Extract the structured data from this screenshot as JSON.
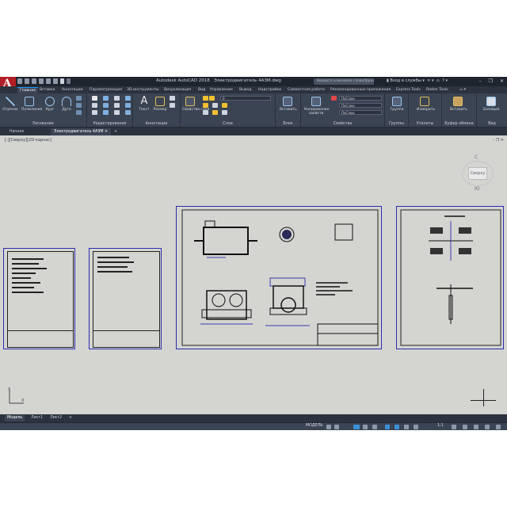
{
  "app": {
    "title": "Autodesk AutoCAD 2018",
    "filename": "Электродвигатель 4АЗМ.dwg",
    "search_placeholder": "Введите ключевое слово/фразу",
    "signin": "Вход в службы"
  },
  "ribbon_tabs": [
    "Главная",
    "Вставка",
    "Аннотации",
    "Параметризация",
    "3D-инструменты",
    "Визуализация",
    "Вид",
    "Управление",
    "Вывод",
    "Надстройки",
    "Совместная работа",
    "Рекомендованные приложения",
    "Express Tools",
    "Raster Tools"
  ],
  "ribbon": {
    "draw": {
      "label": "Рисование",
      "tools": [
        "Отрезок",
        "Полилиния",
        "Круг",
        "Дуга"
      ]
    },
    "modify": {
      "label": "Редактирование"
    },
    "annotation": {
      "label": "Аннотации",
      "tools": [
        "Текст",
        "Размер"
      ]
    },
    "layers": {
      "label": "Слои",
      "properties_button": "Свойства слоя",
      "current_layer": "0"
    },
    "block": {
      "label": "Блок",
      "insert_button": "Вставить"
    },
    "properties": {
      "label": "Свойства",
      "match_button": "Копирование свойств",
      "bylayer": "ПоСлою"
    },
    "groups": {
      "label": "Группы",
      "button": "Группа"
    },
    "utilities": {
      "label": "Утилиты",
      "button": "Измерить"
    },
    "clipboard": {
      "label": "Буфер обмена",
      "button": "Вставить"
    },
    "view": {
      "label": "Вид",
      "button": "Базовый"
    }
  },
  "doc_tabs": [
    "Начало",
    "Электродвигатель 4АЗМ"
  ],
  "viewport": {
    "label": "[-][Сверху][2D-каркас]",
    "cube_face": "Сверху",
    "compass_n": "С",
    "compass_s": "Ю",
    "wcs": "МСК"
  },
  "layout_tabs": [
    "Модель",
    "Лист1",
    "Лист2"
  ],
  "status": {
    "model": "МОДЕЛЬ",
    "scale": "1:1"
  }
}
